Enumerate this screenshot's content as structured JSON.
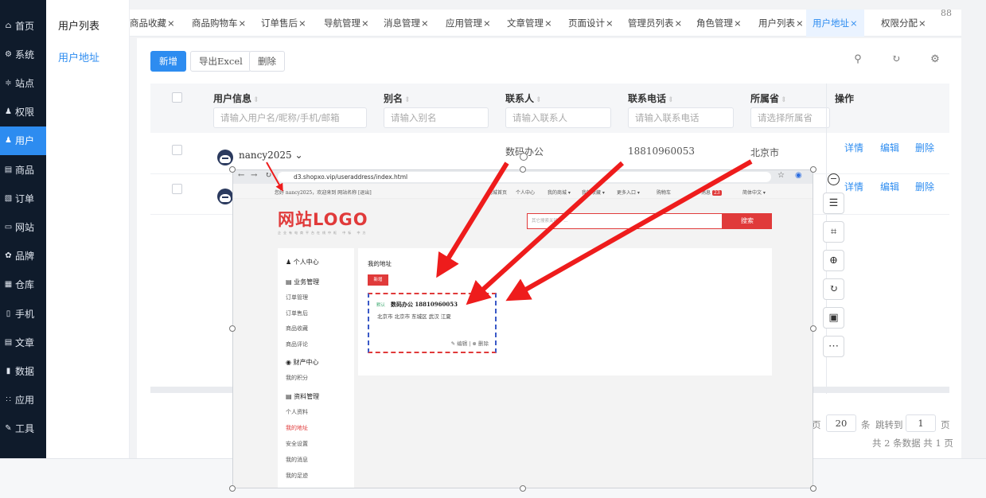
{
  "sidebar": {
    "items": [
      {
        "icon": "home-icon",
        "glyph": "⌂",
        "label": "首页"
      },
      {
        "icon": "gear-icon",
        "glyph": "⚙",
        "label": "系统"
      },
      {
        "icon": "sliders-icon",
        "glyph": "≑",
        "label": "站点"
      },
      {
        "icon": "user-shield-icon",
        "glyph": "♟",
        "label": "权限"
      },
      {
        "icon": "user-icon",
        "glyph": "♟",
        "label": "用户",
        "active": true
      },
      {
        "icon": "shop-icon",
        "glyph": "▤",
        "label": "商品"
      },
      {
        "icon": "clipboard-icon",
        "glyph": "▧",
        "label": "订单"
      },
      {
        "icon": "monitor-icon",
        "glyph": "▭",
        "label": "网站"
      },
      {
        "icon": "badge-icon",
        "glyph": "✿",
        "label": "品牌"
      },
      {
        "icon": "warehouse-icon",
        "glyph": "▦",
        "label": "仓库"
      },
      {
        "icon": "phone-icon",
        "glyph": "▯",
        "label": "手机"
      },
      {
        "icon": "article-icon",
        "glyph": "▤",
        "label": "文章"
      },
      {
        "icon": "chart-icon",
        "glyph": "▮",
        "label": "数据"
      },
      {
        "icon": "apps-icon",
        "glyph": "∷",
        "label": "应用"
      },
      {
        "icon": "wrench-icon",
        "glyph": "✎",
        "label": "工具"
      }
    ]
  },
  "submenu": {
    "title": "用户列表",
    "active_link": "用户地址"
  },
  "tabs": [
    {
      "label": "商品收藏",
      "x": "×"
    },
    {
      "label": "商品购物车",
      "x": "×"
    },
    {
      "label": "订单售后",
      "x": "×"
    },
    {
      "label": "导航管理",
      "x": "×"
    },
    {
      "label": "消息管理",
      "x": "×"
    },
    {
      "label": "应用管理",
      "x": "×"
    },
    {
      "label": "文章管理",
      "x": "×"
    },
    {
      "label": "页面设计",
      "x": "×"
    },
    {
      "label": "管理员列表",
      "x": "×"
    },
    {
      "label": "角色管理",
      "x": "×"
    },
    {
      "label": "用户列表",
      "x": "×"
    },
    {
      "label": "用户地址",
      "x": "×",
      "active": true
    },
    {
      "label": "权限分配",
      "x": "×"
    }
  ],
  "tabs_grid_icon": "88",
  "toolbar": {
    "add": "新增",
    "export": "导出Excel",
    "delete": "删除"
  },
  "table": {
    "columns": [
      "用户信息",
      "别名",
      "联系人",
      "联系电话",
      "所属省",
      "操作"
    ],
    "filters": [
      "请输入用户名/昵称/手机/邮箱",
      "请输入别名",
      "请输入联系人",
      "请输入联系电话",
      "请选择所属省"
    ],
    "rows": [
      {
        "user": "nancy2025",
        "contact": "数码办公",
        "phone": "18810960053",
        "province": "北京市"
      },
      {
        "user": "",
        "contact": "",
        "phone": "",
        "province": ""
      }
    ],
    "actions": [
      "详情",
      "编辑",
      "删除"
    ]
  },
  "pager": {
    "page_size": "20",
    "size_suffix": "条",
    "jump": "跳转到",
    "page": "1",
    "page_suffix": "页",
    "summary": "共 2 条数据 共 1 页",
    "left_fragment": "页"
  },
  "screenshot": {
    "url": "d3.shopxo.vip/useraddress/index.html",
    "welcome": "您好 nancy2025，欢迎来到 网站名称 [退出]",
    "topnav": [
      "商城首页",
      "个人中心",
      "我的商城 ▾",
      "我的收藏 ▾",
      "更多入口 ▾",
      "购物车",
      "消息",
      "简体中文 ▾"
    ],
    "msg_count": "23",
    "logo": "网站LOGO",
    "slogan": "企业有电商平台在线中枢 中标 中方",
    "search_placeholder": "其它搜索关键字 ...",
    "search_button": "搜索",
    "menu": {
      "personal": "个人中心",
      "business": "业务管理",
      "business_items": [
        "订单管理",
        "订单售后",
        "商品收藏",
        "商品评论"
      ],
      "assets": "财产中心",
      "assets_items": [
        "我的积分"
      ],
      "profile": "资料管理",
      "profile_items": [
        "个人资料",
        "我的地址",
        "安全设置",
        "我的消息",
        "我的足迹"
      ]
    },
    "address_title": "我的地址",
    "add_button": "新增",
    "card": {
      "default_tag": "默认",
      "name": "数码办公 18810960053",
      "address": "北京市 北京市 东城区 武汉 江夏",
      "edit": "编辑",
      "delete": "删除"
    }
  },
  "colors": {
    "accent": "#2d8cf0",
    "sidebar": "#0f1b2b",
    "brand_red": "#e03a3a",
    "arrow": "#ee1c1c"
  }
}
